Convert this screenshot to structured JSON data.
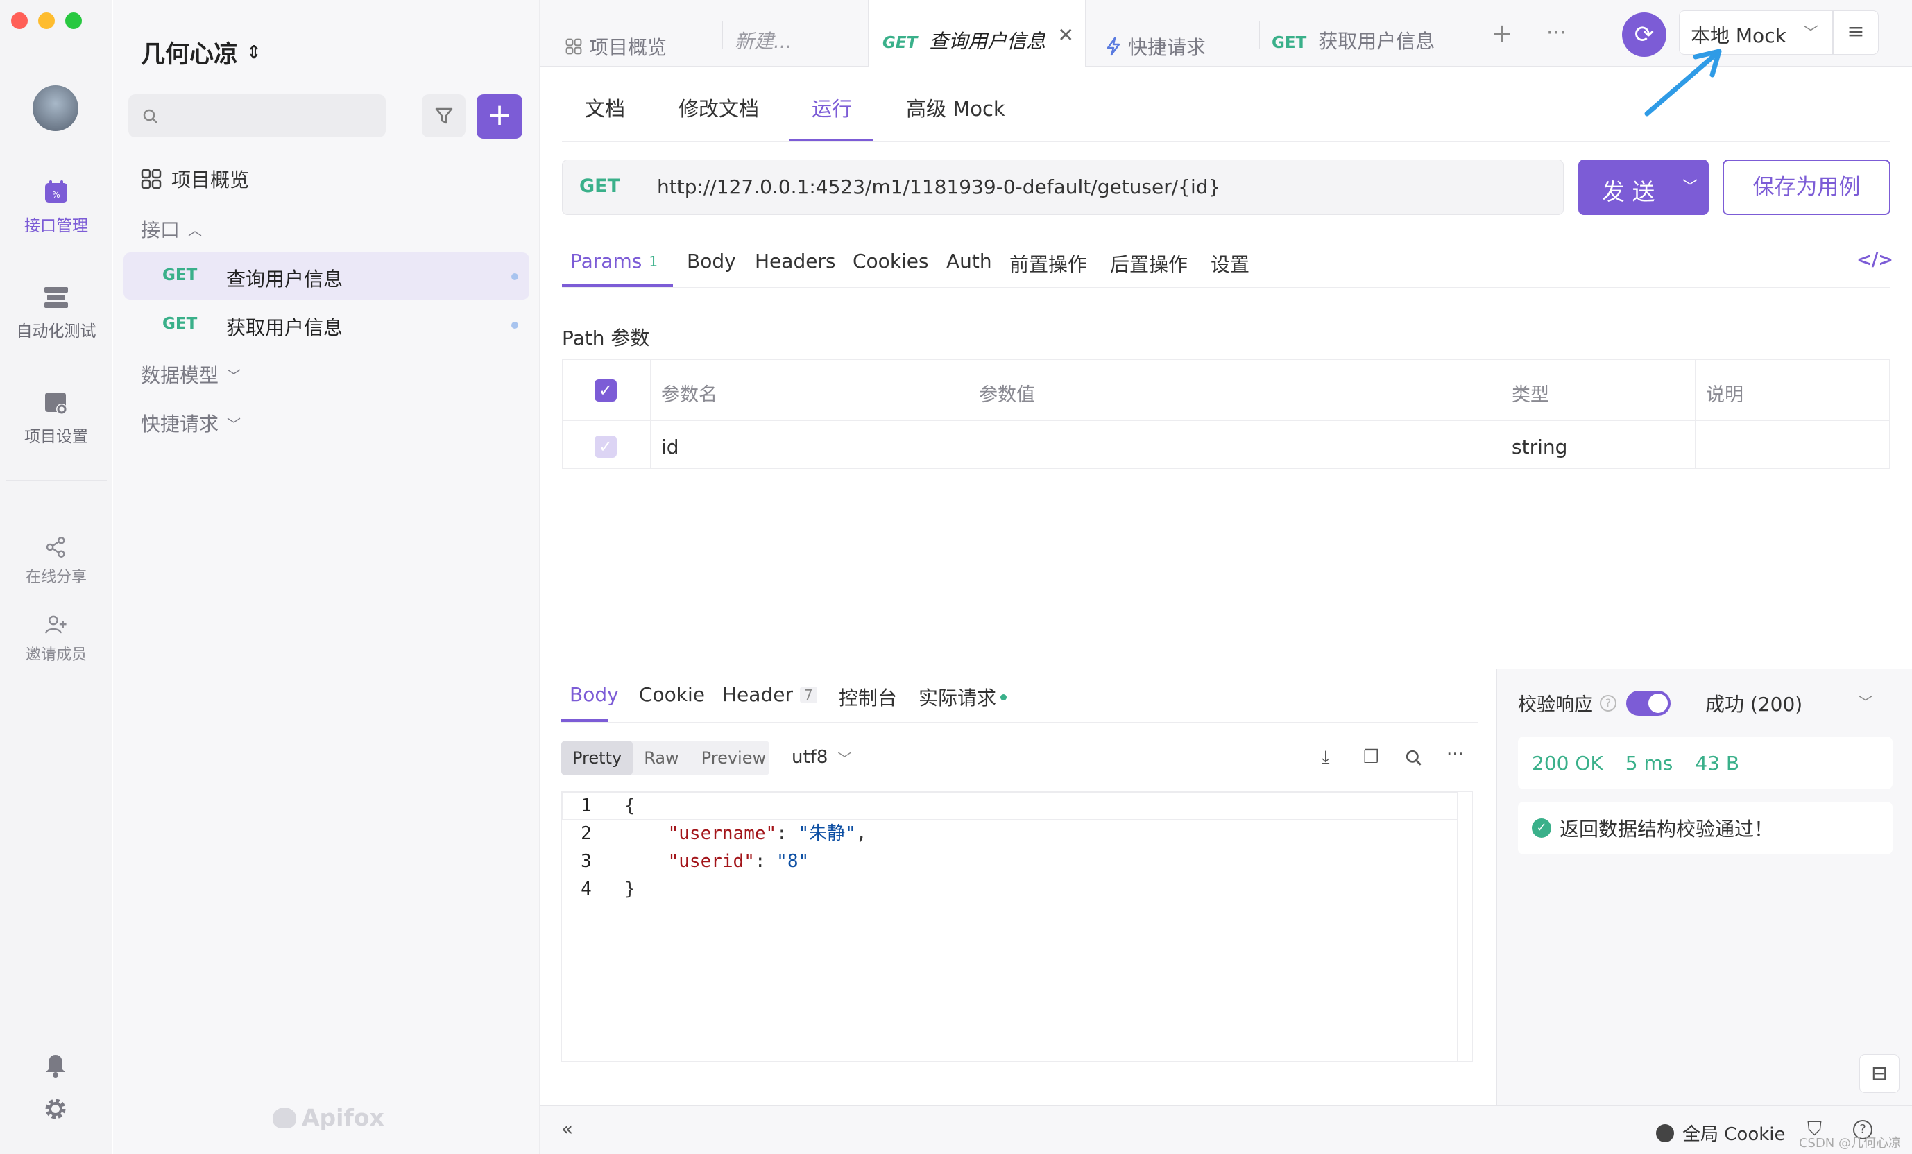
{
  "sidebar_nav": {
    "items": [
      {
        "label": "接口管理",
        "icon": "api-management-icon"
      },
      {
        "label": "自动化测试",
        "icon": "automation-test-icon"
      },
      {
        "label": "项目设置",
        "icon": "project-settings-icon"
      },
      {
        "label": "在线分享",
        "icon": "share-icon"
      },
      {
        "label": "邀请成员",
        "icon": "invite-member-icon"
      }
    ]
  },
  "project": {
    "name": "几何心凉",
    "overview": "项目概览",
    "api_group": "接口",
    "apis": [
      {
        "method": "GET",
        "name": "查询用户信息"
      },
      {
        "method": "GET",
        "name": "获取用户信息"
      }
    ],
    "data_model": "数据模型",
    "quick_request": "快捷请求",
    "brand": "Apifox"
  },
  "tabs": [
    {
      "label": "项目概览"
    },
    {
      "label": "新建..."
    },
    {
      "method": "GET",
      "label": "查询用户信息"
    },
    {
      "label": "快捷请求"
    },
    {
      "method": "GET",
      "label": "获取用户信息"
    }
  ],
  "env": {
    "selected": "本地 Mock"
  },
  "subtabs": [
    "文档",
    "修改文档",
    "运行",
    "高级 Mock"
  ],
  "request": {
    "method": "GET",
    "url": "http://127.0.0.1:4523/m1/1181939-0-default/getuser/{id}",
    "send": "发 送",
    "save": "保存为用例"
  },
  "param_tabs": {
    "params": "Params",
    "params_count": "1",
    "others": [
      "Body",
      "Headers",
      "Cookies",
      "Auth",
      "前置操作",
      "后置操作",
      "设置"
    ]
  },
  "path_params": {
    "title": "Path 参数",
    "headers": [
      "参数名",
      "参数值",
      "类型",
      "说明"
    ],
    "rows": [
      {
        "name": "id",
        "value": "",
        "type": "string",
        "desc": ""
      }
    ]
  },
  "response": {
    "tabs": {
      "body": "Body",
      "cookie": "Cookie",
      "header": "Header",
      "header_count": "7",
      "console": "控制台",
      "actual": "实际请求"
    },
    "modes": [
      "Pretty",
      "Raw",
      "Preview"
    ],
    "encoding": "utf8",
    "lines": [
      {
        "n": "1",
        "t": "{"
      },
      {
        "n": "2",
        "key": "\"username\"",
        "val": "\"朱静\"",
        "tail": ","
      },
      {
        "n": "3",
        "key": "\"userid\"",
        "val": "\"8\"",
        "tail": ""
      },
      {
        "n": "4",
        "t": "}"
      }
    ]
  },
  "verify": {
    "label": "校验响应",
    "result": "成功 (200)",
    "status": "200 OK",
    "time": "5 ms",
    "size": "43 B",
    "message": "返回数据结构校验通过！"
  },
  "footer": {
    "cookie": "全局 Cookie",
    "watermark": "CSDN @几何心凉"
  },
  "colors": {
    "accent": "#7c5cd6",
    "get": "#3ab08a"
  }
}
